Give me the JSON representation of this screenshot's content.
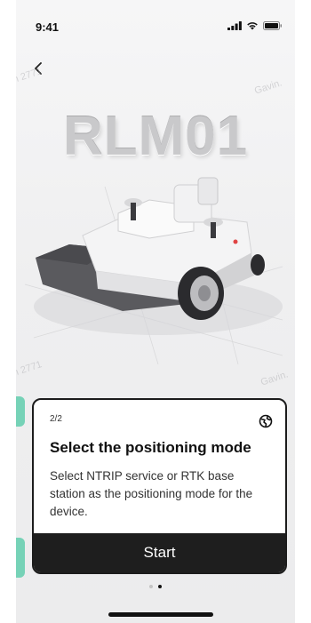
{
  "status_bar": {
    "time": "9:41"
  },
  "hero": {
    "title": "RLM01"
  },
  "card": {
    "step": "2/2",
    "title": "Select the positioning mode",
    "description": "Select NTRIP service or RTK base station as the positioning mode for the device.",
    "start_label": "Start"
  },
  "pagination": {
    "count": 2,
    "active_index": 1
  },
  "icons": {
    "back": "chevron-left-icon",
    "card": "globe-icon",
    "signal": "cellular-signal-icon",
    "wifi": "wifi-icon",
    "battery": "battery-icon"
  },
  "colors": {
    "accent": "#76d2b7",
    "button_bg": "#1e1e1e",
    "title_grey": "#c9c9cb"
  }
}
